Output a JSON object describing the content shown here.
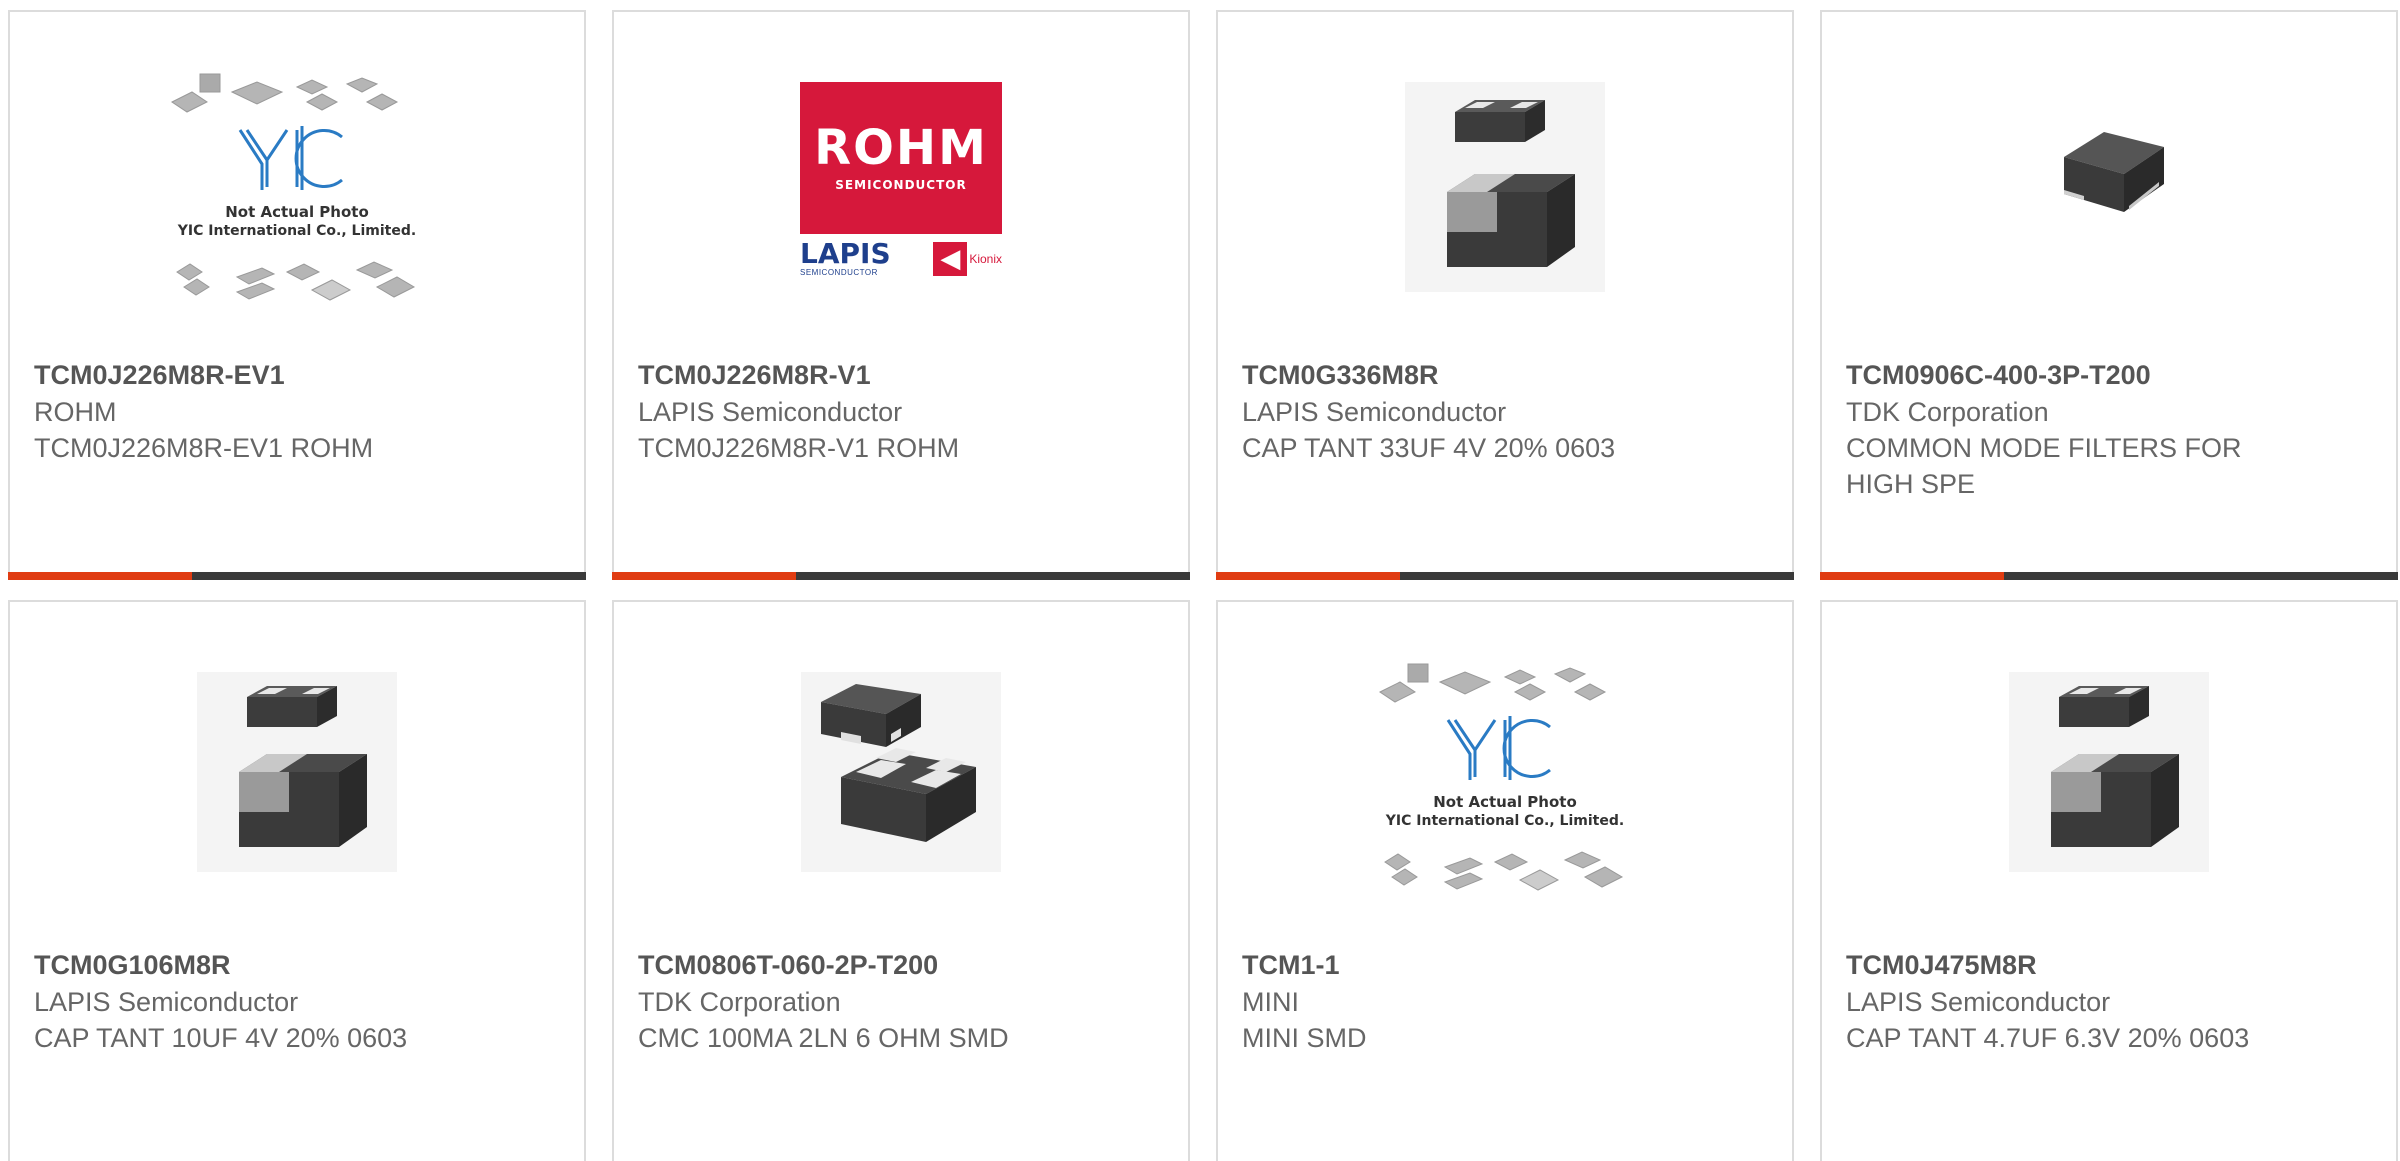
{
  "products": [
    {
      "part_number": "TCM0J226M8R-EV1",
      "manufacturer": "ROHM",
      "description": "TCM0J226M8R-EV1 ROHM",
      "image": "placeholder-not-actual-photo",
      "image_caption_line1": "Not Actual Photo",
      "image_caption_line2": "YIC International Co., Limited."
    },
    {
      "part_number": "TCM0J226M8R-V1",
      "manufacturer": "LAPIS Semiconductor",
      "description": "TCM0J226M8R-V1 ROHM",
      "image": "rohm-logo",
      "logo_main": "ROHM",
      "logo_sub": "SEMICONDUCTOR",
      "logo_lapis": "LAPIS",
      "logo_lapis_sub": "SEMICONDUCTOR",
      "logo_kionix": "Kionix"
    },
    {
      "part_number": "TCM0G336M8R",
      "manufacturer": "LAPIS Semiconductor",
      "description": "CAP TANT 33UF 4V 20% 0603",
      "image": "chip-capacitor-photo"
    },
    {
      "part_number": "TCM0906C-400-3P-T200",
      "manufacturer": "TDK Corporation",
      "description": "COMMON MODE FILTERS FOR HIGH SPE",
      "image": "smd-filter-photo"
    },
    {
      "part_number": "TCM0G106M8R",
      "manufacturer": "LAPIS Semiconductor",
      "description": "CAP TANT 10UF 4V 20% 0603",
      "image": "chip-capacitor-photo"
    },
    {
      "part_number": "TCM0806T-060-2P-T200",
      "manufacturer": "TDK Corporation",
      "description": "CMC 100MA 2LN 6 OHM SMD",
      "image": "smd-cmc-photo"
    },
    {
      "part_number": "TCM1-1",
      "manufacturer": "MINI",
      "description": "MINI SMD",
      "image": "placeholder-not-actual-photo",
      "image_caption_line1": "Not Actual Photo",
      "image_caption_line2": "YIC International Co., Limited."
    },
    {
      "part_number": "TCM0J475M8R",
      "manufacturer": "LAPIS Semiconductor",
      "description": "CAP TANT 4.7UF 6.3V 20% 0603",
      "image": "chip-capacitor-photo"
    }
  ],
  "colors": {
    "accent_bar": "#e03c12",
    "dark_bar": "#3a3a3a",
    "border": "#dcdcdc",
    "rohm_red": "#d6183b",
    "lapis_blue": "#1e3f8c",
    "yic_blue": "#2a7bc4"
  }
}
